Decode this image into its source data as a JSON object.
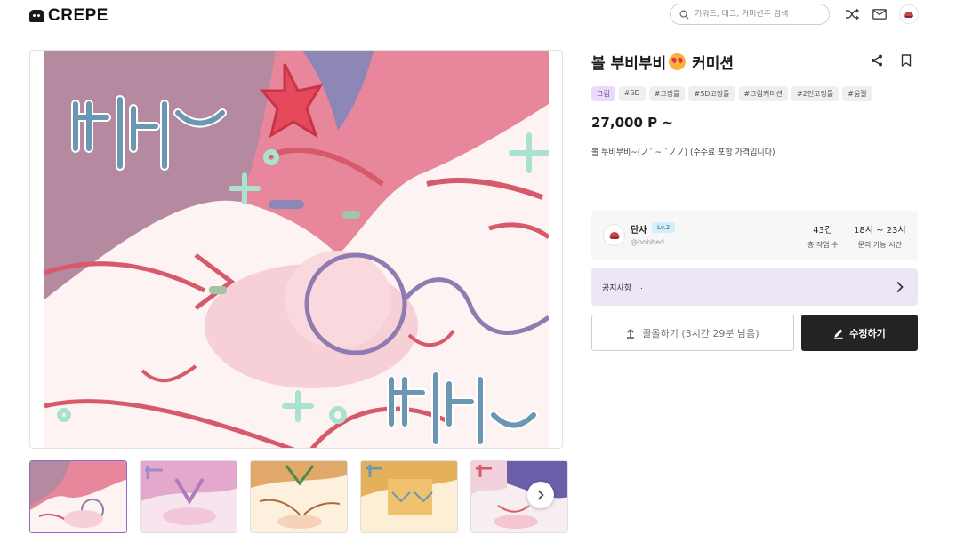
{
  "header": {
    "logo_text": "CREPE",
    "search_placeholder": "키워드, 태그, 커미션주 검색"
  },
  "icons": {
    "logo": "crepe-logo-icon",
    "search": "search-icon",
    "shuffle": "shuffle-icon",
    "mail": "mail-icon",
    "profile": "avatar",
    "share": "share-icon",
    "bookmark": "bookmark-icon",
    "next": "chevron-right-icon",
    "bump": "upload-arrow-icon",
    "edit": "pencil-icon"
  },
  "gallery": {
    "image_texts": [
      "부비~",
      "부비~"
    ],
    "thumbnail_count": 5,
    "active_thumbnail": 1
  },
  "product": {
    "title_before": "볼 부비부비",
    "title_emoji": "smiling-face-with-hearts",
    "title_after": "커미션",
    "tags": [
      "그림",
      "#SD",
      "#고정틀",
      "#SD고정틀",
      "#그림커미션",
      "#2인고정틀",
      "#움짤"
    ],
    "price": "27,000 P ~",
    "description": "볼 부비부비~(ノ´ ~ `ノノ) (수수료 포함 가격입니다)"
  },
  "artist": {
    "name": "단사",
    "level": "Lv.2",
    "handle": "@bobbed",
    "stats": [
      {
        "value": "43건",
        "label": "총 작업 수"
      },
      {
        "value": "18시 ~ 23시",
        "label": "문의 가능 시간"
      }
    ]
  },
  "notice": {
    "label": "공지사항",
    "text": "."
  },
  "actions": {
    "bump_label": "끌올하기 (3시간 29분 남음)",
    "edit_label": "수정하기"
  },
  "colors": {
    "accent_purple": "#6b3fa0",
    "tag_primary_bg": "#eadcf7",
    "notice_bg": "#ede6f5",
    "edit_button_bg": "#232323",
    "artwork_pink": "#e8869c",
    "artwork_red": "#d65a6a",
    "artwork_blue": "#6a97b4",
    "artwork_mint": "#a9e2cf"
  }
}
